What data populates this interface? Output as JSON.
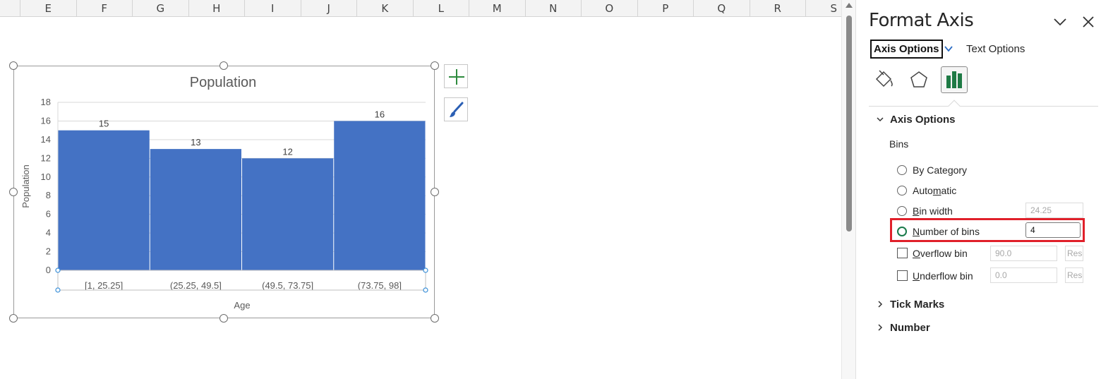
{
  "spreadsheet": {
    "columns": [
      "E",
      "F",
      "G",
      "H",
      "I",
      "J",
      "K",
      "L",
      "M",
      "N",
      "O",
      "P",
      "Q",
      "R",
      "S"
    ]
  },
  "chart_data": {
    "type": "bar",
    "title": "Population",
    "xlabel": "Age",
    "ylabel": "Population",
    "categories": [
      "[1, 25.25]",
      "(25.25, 49.5]",
      "(49.5, 73.75]",
      "(73.75, 98]"
    ],
    "values": [
      15,
      13,
      12,
      16
    ],
    "ylim": [
      0,
      18
    ],
    "yticks": [
      "0",
      "2",
      "4",
      "6",
      "8",
      "10",
      "12",
      "14",
      "16",
      "18"
    ],
    "bar_color": "#4472c4",
    "grid": true
  },
  "chart_buttons": {
    "add_icon": "plus-icon",
    "style_icon": "paintbrush-icon"
  },
  "pane": {
    "title": "Format Axis",
    "tabs": {
      "axis_options": "Axis Options",
      "text_options": "Text Options"
    },
    "category_icons": [
      "paint-bucket-icon",
      "pentagon-icon",
      "bar-chart-icon"
    ],
    "section_axis_options": "Axis Options",
    "bins_label": "Bins",
    "options": {
      "by_category": {
        "pre": "By Cate",
        "u": "g",
        "post": "ory"
      },
      "automatic": {
        "pre": "Auto",
        "u": "m",
        "post": "atic"
      },
      "bin_width": {
        "pre": "",
        "u": "B",
        "post": "in width",
        "value": "24.25"
      },
      "number_of_bins": {
        "pre": "",
        "u": "N",
        "post": "umber of bins",
        "value": "4"
      },
      "overflow_bin": {
        "pre": "",
        "u": "O",
        "post": "verflow bin",
        "value": "90.0"
      },
      "underflow_bin": {
        "pre": "",
        "u": "U",
        "post": "nderflow bin",
        "value": "0.0"
      },
      "reset_label": "Rese"
    },
    "selected_option": "number_of_bins",
    "section_tick_marks": "Tick Marks",
    "section_number": "Number",
    "accent_color": "#1a7a4a",
    "highlight_color": "#e0202a"
  }
}
